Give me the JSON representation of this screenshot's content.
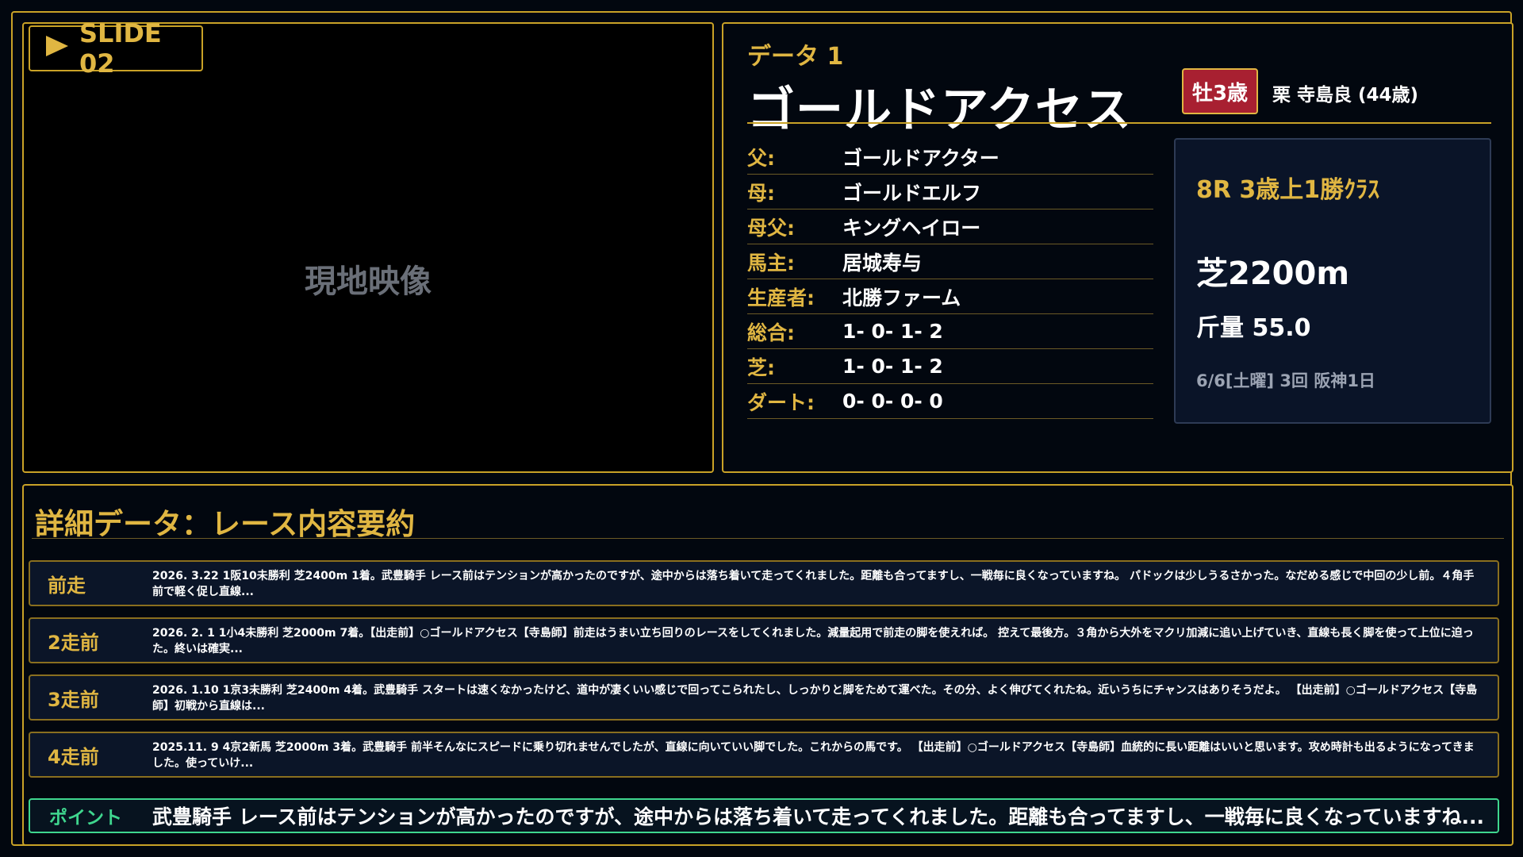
{
  "slide": {
    "label": "SLIDE 02"
  },
  "video": {
    "label": "現地映像"
  },
  "horse": {
    "data_label": "データ 1",
    "name": "ゴールドアクセス",
    "sex_age": "牡3歳",
    "jockey_info": "栗 寺島良 (44歳)",
    "rows": [
      {
        "key": "父:",
        "value": "ゴールドアクター"
      },
      {
        "key": "母:",
        "value": "ゴールドエルフ"
      },
      {
        "key": "母父:",
        "value": "キングヘイロー"
      },
      {
        "key": "馬主:",
        "value": "居城寿与"
      },
      {
        "key": "生産者:",
        "value": "北勝ファーム"
      },
      {
        "key": "総合:",
        "value": "1- 0- 1- 2"
      },
      {
        "key": "芝:",
        "value": "1- 0- 1- 2"
      },
      {
        "key": "ダート:",
        "value": "0- 0- 0- 0"
      }
    ]
  },
  "race": {
    "name": "8R 3歳上1勝ｸﾗｽ",
    "distance": "芝2200m",
    "weight": "斤量 55.0",
    "date": "6/6[土曜] 3回 阪神1日"
  },
  "detail": {
    "title": "詳細データ：レース内容要約",
    "runs": [
      {
        "label": "前走",
        "text": "2026. 3.22 1阪10未勝利 芝2400m 1着。武豊騎手 レース前はテンションが高かったのですが、途中からは落ち着いて走ってくれました。距離も合ってますし、一戦毎に良くなっていますね。 パドックは少しうるさかった。なだめる感じで中回の少し前。４角手前で軽く促し直線..."
      },
      {
        "label": "2走前",
        "text": "2026. 2. 1 1小4未勝利 芝2000m 7着。【出走前】○ゴールドアクセス【寺島師】前走はうまい立ち回りのレースをしてくれました。減量起用で前走の脚を使えれば。 控えて最後方。３角から大外をマクリ加減に追い上げていき、直線も長く脚を使って上位に迫った。終いは確実..."
      },
      {
        "label": "3走前",
        "text": "2026. 1.10 1京3未勝利 芝2400m 4着。武豊騎手 スタートは速くなかったけど、道中が凄くいい感じで回ってこられたし、しっかりと脚をためて運べた。その分、よく伸びてくれたね。近いうちにチャンスはありそうだよ。 【出走前】○ゴールドアクセス【寺島師】初戦から直線は..."
      },
      {
        "label": "4走前",
        "text": "2025.11. 9 4京2新馬 芝2000m 3着。武豊騎手 前半そんなにスピードに乗り切れませんでしたが、直線に向いていい脚でした。これからの馬です。 【出走前】○ゴールドアクセス【寺島師】血統的に長い距離はいいと思います。攻め時計も出るようになってきました。使っていけ..."
      }
    ],
    "point": {
      "label": "ポイント",
      "text": "武豊騎手 レース前はテンションが高かったのですが、途中からは落ち着いて走ってくれました。距離も合ってますし、一戦毎に良くなっていますね..."
    }
  },
  "colors": {
    "accent": "#e0b642",
    "badge": "#a82031",
    "point": "#3fd68e",
    "background": "#02070f"
  }
}
